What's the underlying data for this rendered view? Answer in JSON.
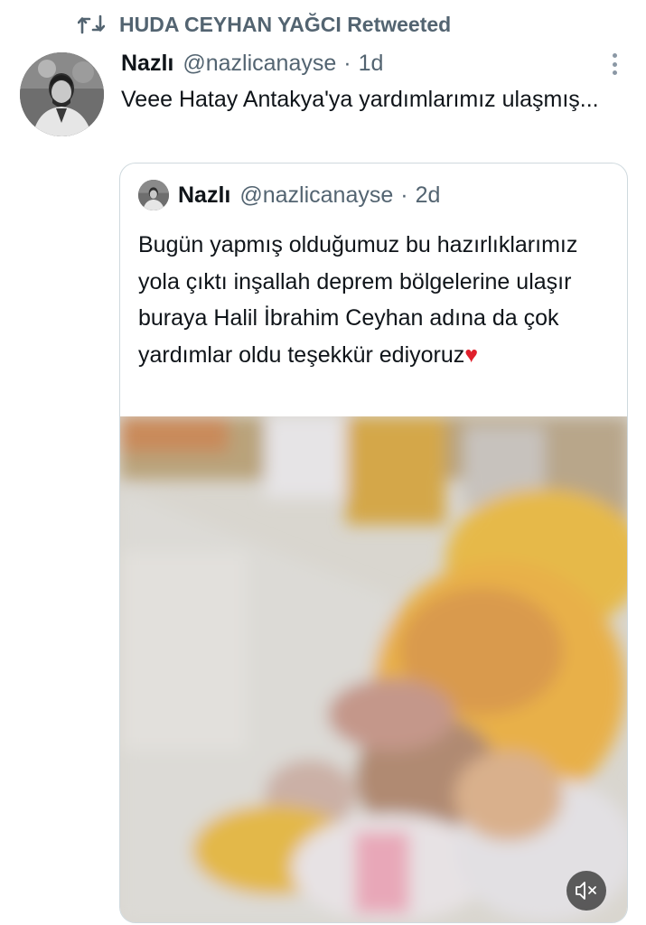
{
  "retweet": {
    "icon": "retweet-icon",
    "text": "HUDA CEYHAN YAĞCI Retweeted"
  },
  "tweet": {
    "author_name": "Nazlı",
    "author_handle": "@nazlicanayse",
    "separator": "·",
    "time": "1d",
    "text": "Veee Hatay Antakya'ya yardımlarımız ulaşmış...",
    "more_icon": "more-vertical-icon"
  },
  "quote": {
    "author_name": "Nazlı",
    "author_handle": "@nazlicanayse",
    "separator": "·",
    "time": "2d",
    "text": "Bugün yapmış olduğumuz bu hazırlıklarımız yola çıktı inşallah deprem bölgelerine ulaşır buraya Halil İbrahim Ceyhan adına da çok yardımlar oldu teşekkür ediyoruz",
    "heart": "♥",
    "video": {
      "mute_icon": "speaker-muted-icon"
    }
  },
  "colors": {
    "text_primary": "#0f1419",
    "text_secondary": "#536471",
    "border": "#cfd9de",
    "heart": "#e0202b"
  }
}
